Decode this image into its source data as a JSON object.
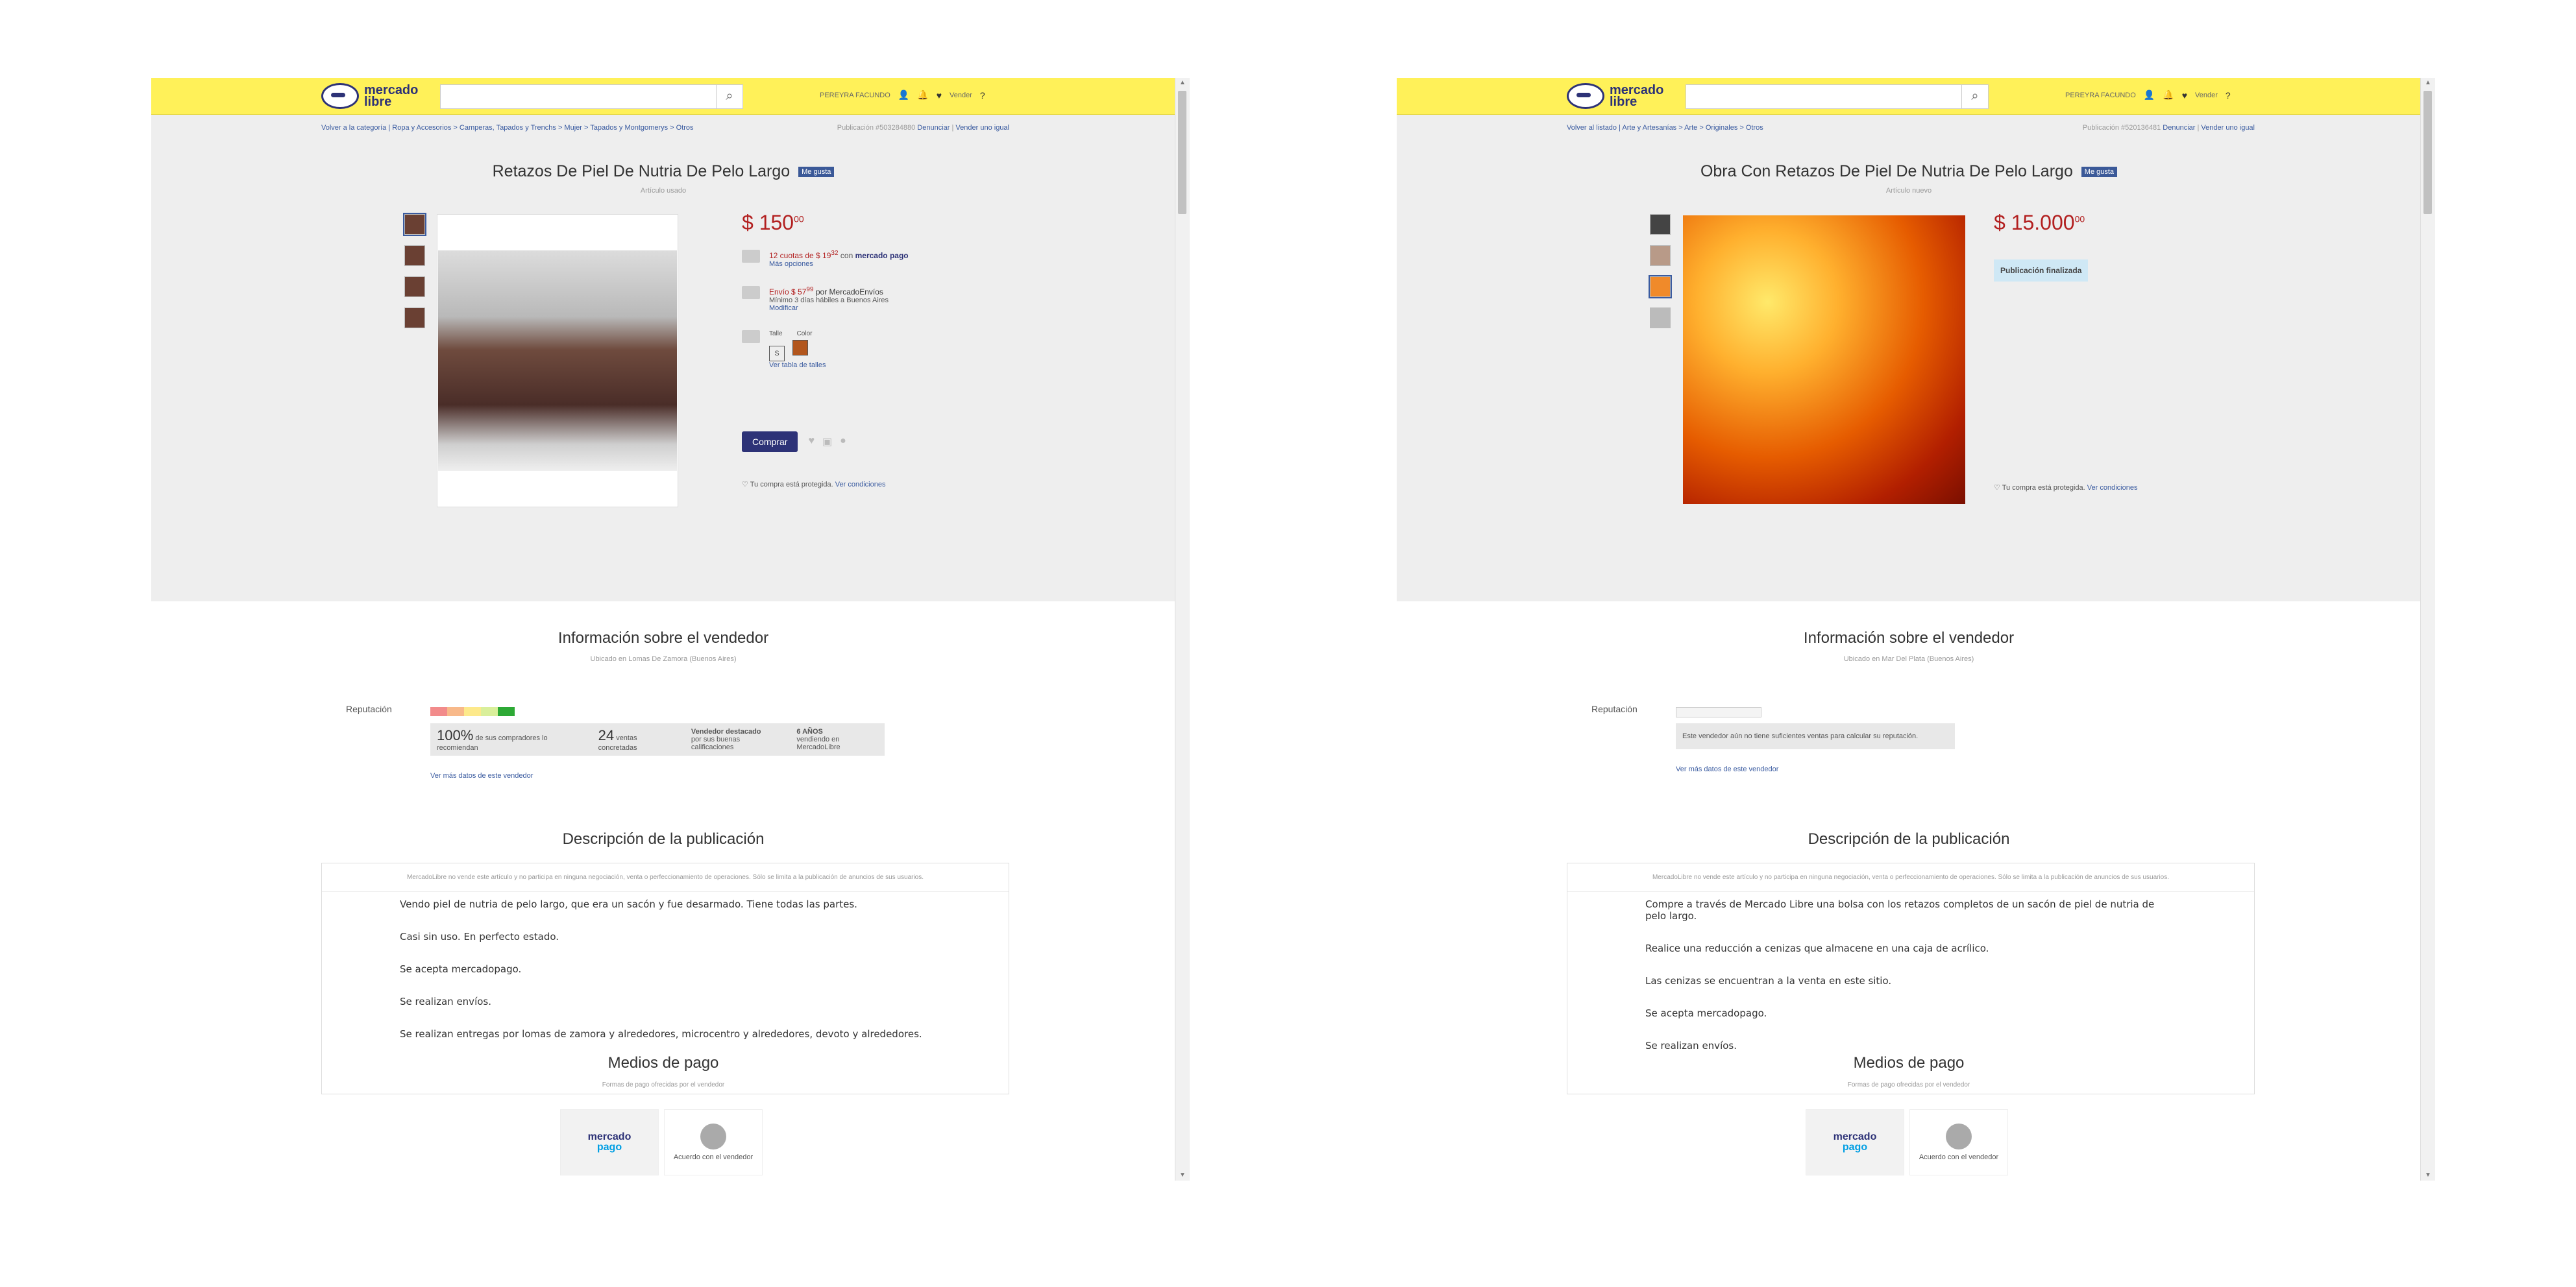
{
  "screens": [
    {
      "header": {
        "logo_line1": "mercado",
        "logo_line2": "libre",
        "user_name": "PEREYRA FACUNDO",
        "sell_label": "Vender",
        "help_label": "?"
      },
      "breadcrumb": {
        "back": "Volver a la categoría",
        "path": "Ropa y Accesorios > Camperas, Tapados y Trenchs > Mujer > Tapados y Montgomerys > Otros",
        "publication": "Publicación #503284880",
        "report": "Denunciar",
        "sell_same": "Vender uno igual"
      },
      "product": {
        "title": "Retazos De Piel De Nutria De Pelo Largo",
        "like": "Me gusta",
        "condition": "Artículo usado",
        "price": "$ 150",
        "price_cents": "00",
        "installments": "12 cuotas de $ 19",
        "installments_cents": "32",
        "with_label": "con",
        "mercadopago": "mercado pago",
        "more_options": "Más opciones",
        "shipping": "Envío $ 57",
        "shipping_cents": "99",
        "shipping_by": "por MercadoEnvíos",
        "shipping_days": "Mínimo 3 días hábiles a Buenos Aires",
        "modify": "Modificar",
        "size_label": "Talle",
        "size_value": "S",
        "color_label": "Color",
        "size_table": "Ver tabla de talles",
        "buy": "Comprar",
        "protect": "Tu compra está protegida.",
        "conditions": "Ver condiciones"
      },
      "seller": {
        "title": "Información sobre el vendedor",
        "location": "Ubicado en Lomas De Zamora (Buenos Aires)",
        "rep_label": "Reputación",
        "pct": "100%",
        "pct_text": "de sus compradores lo recomiendan",
        "sales": "24",
        "sales_text": "ventas concretadas",
        "highlight": "Vendedor destacado",
        "highlight_text": "por sus buenas calificaciones",
        "years": "6 AÑOS",
        "years_text": "vendiendo en MercadoLibre",
        "more": "Ver más datos de este vendedor"
      },
      "description": {
        "title": "Descripción de la publicación",
        "disclaimer": "MercadoLibre no vende este artículo y no participa en ninguna negociación, venta o perfeccionamiento de operaciones. Sólo se limita a la publicación de anuncios de sus usuarios.",
        "lines": [
          "Vendo piel de nutria de pelo largo, que era un sacón y fue desarmado. Tiene todas las partes.",
          "Casi sin uso. En perfecto estado.",
          "Se acepta mercadopago.",
          "Se realizan envíos.",
          "Se realizan entregas por lomas de zamora y alrededores, microcentro y alrededores, devoto y alrededores."
        ]
      },
      "payment": {
        "title": "Medios de pago",
        "subtitle": "Formas de pago ofrecidas por el vendedor",
        "mp_line1": "mercado",
        "mp_line2": "pago",
        "agree": "Acuerdo con el vendedor"
      }
    },
    {
      "header": {
        "logo_line1": "mercado",
        "logo_line2": "libre",
        "user_name": "PEREYRA FACUNDO",
        "sell_label": "Vender",
        "help_label": "?"
      },
      "breadcrumb": {
        "back": "Volver al listado",
        "path": "Arte y Artesanías > Arte > Originales > Otros",
        "publication": "Publicación #520136481",
        "report": "Denunciar",
        "sell_same": "Vender uno igual"
      },
      "product": {
        "title": "Obra Con Retazos De Piel De Nutria De Pelo Largo",
        "like": "Me gusta",
        "condition": "Artículo nuevo",
        "price": "$ 15.000",
        "price_cents": "00",
        "finished": "Publicación finalizada",
        "protect": "Tu compra está protegida.",
        "conditions": "Ver condiciones"
      },
      "seller": {
        "title": "Información sobre el vendedor",
        "location": "Ubicado en Mar Del Plata (Buenos Aires)",
        "rep_label": "Reputación",
        "no_sales": "Este vendedor aún no tiene suficientes ventas para calcular su reputación.",
        "more": "Ver más datos de este vendedor"
      },
      "description": {
        "title": "Descripción de la publicación",
        "disclaimer": "MercadoLibre no vende este artículo y no participa en ninguna negociación, venta o perfeccionamiento de operaciones. Sólo se limita a la publicación de anuncios de sus usuarios.",
        "lines": [
          "Compre a través de Mercado Libre una bolsa con los retazos completos de un sacón de piel de nutria de pelo largo.",
          "Realice una reducción a cenizas que almacene en una caja de acrílico.",
          "Las cenizas se encuentran a la venta en este sitio.",
          "Se acepta mercadopago.",
          "Se realizan envíos."
        ]
      },
      "payment": {
        "title": "Medios de pago",
        "subtitle": "Formas de pago ofrecidas por el vendedor",
        "mp_line1": "mercado",
        "mp_line2": "pago",
        "agree": "Acuerdo con el vendedor"
      }
    }
  ],
  "colors": {
    "header_yellow": "#fff159",
    "brand_blue": "#2d3277",
    "price_red": "#b21f1f",
    "link_blue": "#3a5ba0"
  }
}
